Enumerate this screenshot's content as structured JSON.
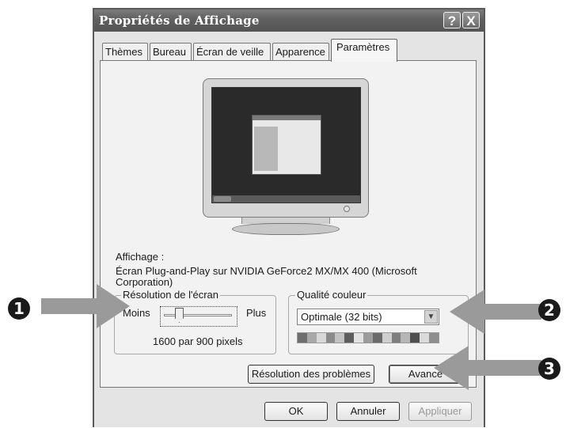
{
  "window": {
    "title": "Propriétés de Affichage",
    "help_btn": "?",
    "close_btn": "X"
  },
  "tabs": [
    {
      "label": "Thèmes"
    },
    {
      "label": "Bureau"
    },
    {
      "label": "Écran de veille"
    },
    {
      "label": "Apparence"
    },
    {
      "label": "Paramètres"
    }
  ],
  "active_tab": "Paramètres",
  "display": {
    "label": "Affichage :",
    "device_line1": "Écran Plug-and-Play sur NVIDIA GeForce2 MX/MX 400 (Microsoft",
    "device_line2": "Corporation)"
  },
  "resolution": {
    "group_label": "Résolution de l'écran",
    "less": "Moins",
    "more": "Plus",
    "value_text": "1600 par 900 pixels",
    "slider_position": 0.22
  },
  "color_quality": {
    "group_label": "Qualité couleur",
    "selected": "Optimale (32 bits)",
    "swatches": [
      "#6e6e6e",
      "#a8a8a8",
      "#d8d8d8",
      "#8a8a8a",
      "#c2c2c2",
      "#5c5c5c",
      "#e2e2e2",
      "#9c9c9c",
      "#6a6a6a",
      "#cfcfcf",
      "#7e7e7e",
      "#b6b6b6",
      "#4e4e4e",
      "#dadada",
      "#8e8e8e"
    ]
  },
  "buttons": {
    "troubleshoot": "Résolution des problèmes",
    "advanced": "Avancé",
    "ok": "OK",
    "cancel": "Annuler",
    "apply": "Appliquer"
  },
  "callouts": {
    "one": "❶",
    "two": "❷",
    "three": "❸"
  }
}
